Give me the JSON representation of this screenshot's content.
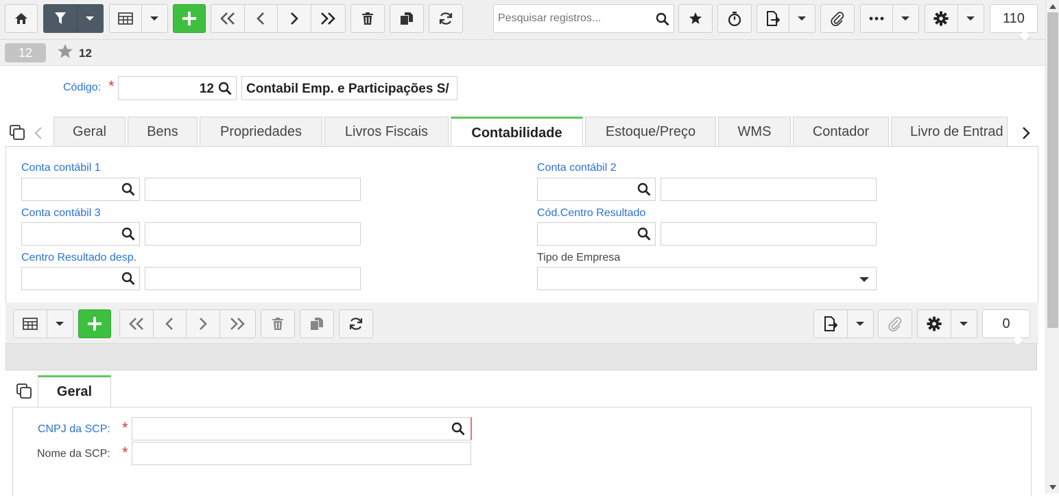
{
  "toolbar": {
    "search_placeholder": "Pesquisar registros...",
    "record_count": "110"
  },
  "record_bar": {
    "badge": "12",
    "title": "12"
  },
  "header_form": {
    "code_label": "Código:",
    "code_value": "12",
    "name_value": "Contabil Emp. e Participações S/"
  },
  "tabs": [
    "Geral",
    "Bens",
    "Propriedades",
    "Livros Fiscais",
    "Contabilidade",
    "Estoque/Preço",
    "WMS",
    "Contador",
    "Livro de Entrad"
  ],
  "fields": {
    "conta1": "Conta contábil 1",
    "conta2": "Conta contábil 2",
    "conta3": "Conta contábil 3",
    "centro_resultado": "Cód.Centro Resultado",
    "centro_desp": "Centro Resultado desp.",
    "tipo_empresa": "Tipo de Empresa"
  },
  "sub_toolbar": {
    "record_count": "0"
  },
  "sub_tabs": [
    "Geral"
  ],
  "sub_form": {
    "cnpj_label": "CNPJ da SCP:",
    "nome_label": "Nome da SCP:"
  },
  "colors": {
    "accent_blue": "#2a72d6",
    "active_tab": "#5cc85c",
    "add_button": "#3fbf3f",
    "filter_button": "#4d5a66",
    "required": "#d93b3b"
  }
}
